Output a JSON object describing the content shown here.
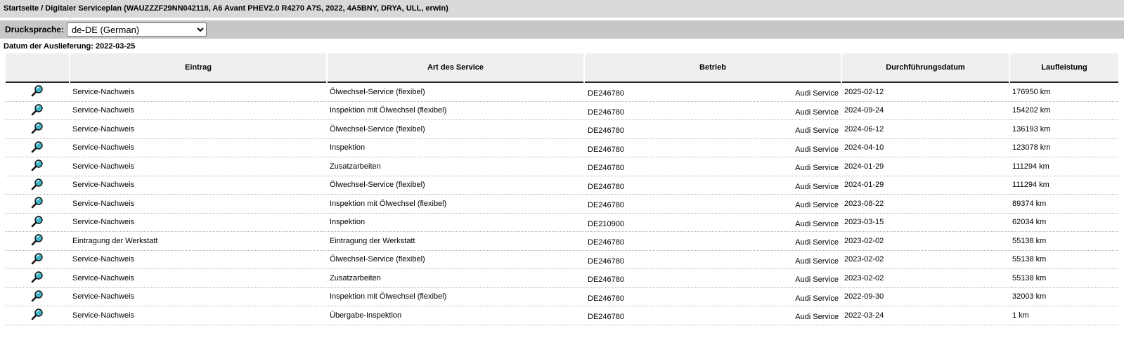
{
  "breadcrumb": "Startseite / Digitaler Serviceplan (WAUZZZF29NN042118, A6 Avant PHEV2.0 R4270 A7S, 2022, 4A5BNY, DRYA, ULL, erwin)",
  "print_language": {
    "label": "Drucksprache:",
    "selected": "de-DE (German)"
  },
  "delivery_date": "Datum der Auslieferung: 2022-03-25",
  "table": {
    "headers": [
      "Eintrag",
      "Art des Service",
      "Betrieb",
      "Durchführungsdatum",
      "Laufleistung"
    ],
    "rows": [
      {
        "entry": "Service-Nachweis",
        "service": "Ölwechsel-Service (flexibel)",
        "code": "DE246780",
        "dealer": "Audi Service",
        "date": "2025-02-12",
        "mileage": "176950 km"
      },
      {
        "entry": "Service-Nachweis",
        "service": "Inspektion mit Ölwechsel (flexibel)",
        "code": "DE246780",
        "dealer": "Audi Service",
        "date": "2024-09-24",
        "mileage": "154202 km"
      },
      {
        "entry": "Service-Nachweis",
        "service": "Ölwechsel-Service (flexibel)",
        "code": "DE246780",
        "dealer": "Audi Service",
        "date": "2024-06-12",
        "mileage": "136193 km"
      },
      {
        "entry": "Service-Nachweis",
        "service": "Inspektion",
        "code": "DE246780",
        "dealer": "Audi Service",
        "date": "2024-04-10",
        "mileage": "123078 km"
      },
      {
        "entry": "Service-Nachweis",
        "service": "Zusatzarbeiten",
        "code": "DE246780",
        "dealer": "Audi Service",
        "date": "2024-01-29",
        "mileage": "111294 km"
      },
      {
        "entry": "Service-Nachweis",
        "service": "Ölwechsel-Service (flexibel)",
        "code": "DE246780",
        "dealer": "Audi Service",
        "date": "2024-01-29",
        "mileage": "111294 km"
      },
      {
        "entry": "Service-Nachweis",
        "service": "Inspektion mit Ölwechsel (flexibel)",
        "code": "DE246780",
        "dealer": "Audi Service",
        "date": "2023-08-22",
        "mileage": "89374 km"
      },
      {
        "entry": "Service-Nachweis",
        "service": "Inspektion",
        "code": "DE210900",
        "dealer": "Audi Service",
        "date": "2023-03-15",
        "mileage": "62034 km"
      },
      {
        "entry": "Eintragung der Werkstatt",
        "service": "Eintragung der Werkstatt",
        "code": "DE246780",
        "dealer": "Audi Service",
        "date": "2023-02-02",
        "mileage": "55138 km"
      },
      {
        "entry": "Service-Nachweis",
        "service": "Ölwechsel-Service (flexibel)",
        "code": "DE246780",
        "dealer": "Audi Service",
        "date": "2023-02-02",
        "mileage": "55138 km"
      },
      {
        "entry": "Service-Nachweis",
        "service": "Zusatzarbeiten",
        "code": "DE246780",
        "dealer": "Audi Service",
        "date": "2023-02-02",
        "mileage": "55138 km"
      },
      {
        "entry": "Service-Nachweis",
        "service": "Inspektion mit Ölwechsel (flexibel)",
        "code": "DE246780",
        "dealer": "Audi Service",
        "date": "2022-09-30",
        "mileage": "32003 km"
      },
      {
        "entry": "Service-Nachweis",
        "service": "Übergabe-Inspektion",
        "code": "DE246780",
        "dealer": "Audi Service",
        "date": "2022-03-24",
        "mileage": "1 km"
      }
    ]
  },
  "icons": {
    "row_detail": "magnifier-icon"
  },
  "colors": {
    "titlebar_bg": "#d9d9d9",
    "langbar_bg": "#c7c7c7",
    "header_bg": "#efefef",
    "magnifier_lens": "#40b7c9"
  }
}
